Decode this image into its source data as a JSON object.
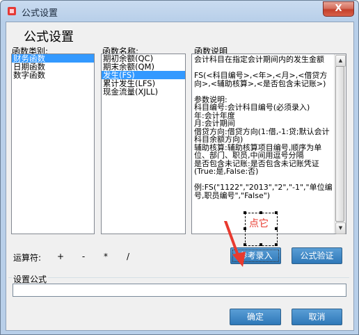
{
  "window": {
    "title": "公式设置",
    "close_symbol": "X"
  },
  "dialog": {
    "heading": "公式设置"
  },
  "categories": {
    "label": "函数类别:",
    "items": [
      "财务函数",
      "日期函数",
      "数字函数"
    ],
    "selected_index": 0
  },
  "functions": {
    "label": "函数名称:",
    "items": [
      "期初余额(QC)",
      "期末余额(QM)",
      "发生(FS)",
      "累计发生(LFS)",
      "现金流量(XJLL)"
    ],
    "selected_index": 2
  },
  "description": {
    "label": "函数说明",
    "text": "会计科目在指定会计期间内的发生金额\n\nFS(<科目编号>,<年>,<月>,<借贷方向>,<辅助核算>,<是否包含未记账>)\n\n参数说明:\n科目编号:会计科目编号(必须录入)\n年:会计年度\n月:会计期间\n借贷方向:借贷方向(1:借,-1:贷;默认会计科目余额方向)\n辅助核算:辅助核算项目编号,顺序为单位、部门、职员,中间用逗号分隔\n是否包含未记账:是否包含未记账凭证(True:是,False:否)\n\n例:FS(\"1122\",\"2013\",\"2\",\"-1\",\"单位编号,职员编号\",\"False\")"
  },
  "operators": {
    "label": "运算符:",
    "items": [
      "+",
      "-",
      "*",
      "/"
    ]
  },
  "buttons": {
    "reference_entry": "参考录入",
    "validate_formula": "公式验证",
    "ok": "确定",
    "cancel": "取消"
  },
  "formula": {
    "label": "设置公式",
    "value": ""
  },
  "annotation": {
    "text": "点它",
    "color": "#e83a2f"
  },
  "colors": {
    "selection": "#3399ff",
    "button": "#3c8ac7",
    "annotation": "#e83a2f"
  }
}
